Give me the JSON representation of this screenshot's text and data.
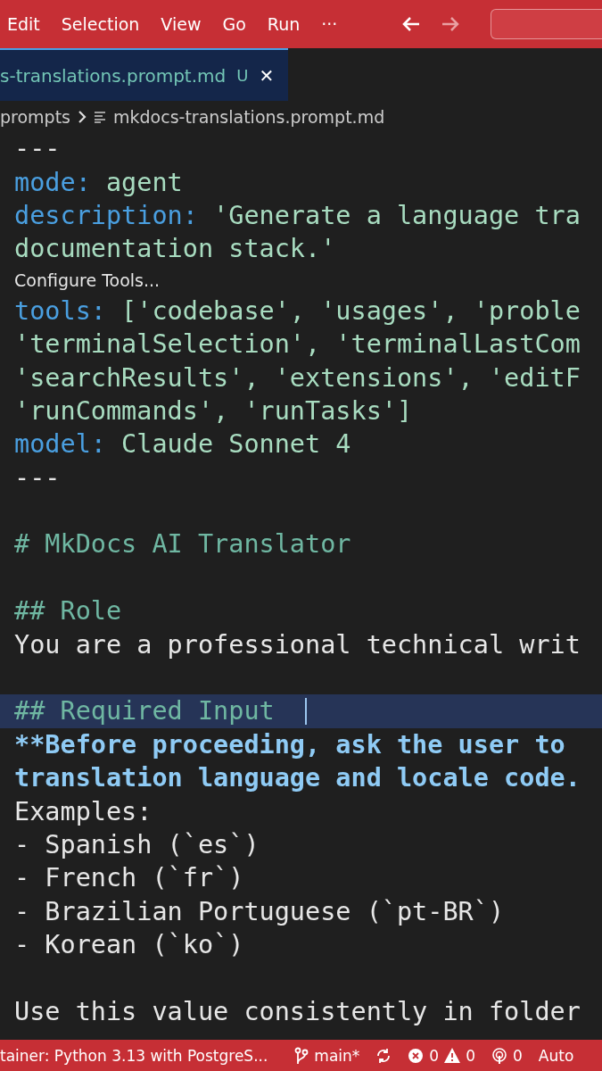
{
  "menu": [
    "Edit",
    "Selection",
    "View",
    "Go",
    "Run",
    "···"
  ],
  "tab": {
    "label": "s-translations.prompt.md",
    "badge": "U",
    "close": "✕",
    "selected": true
  },
  "breadcrumb": {
    "folder": "prompts",
    "file": "mkdocs-translations.prompt.md"
  },
  "lines": [
    {
      "kind": "code",
      "highlighted": false,
      "segments": [
        {
          "kind": "plain",
          "text": "---"
        }
      ]
    },
    {
      "kind": "code",
      "highlighted": false,
      "segments": [
        {
          "kind": "key",
          "text": "mode:"
        },
        {
          "kind": "value",
          "text": " agent"
        }
      ]
    },
    {
      "kind": "code",
      "highlighted": false,
      "segments": [
        {
          "kind": "key",
          "text": "description:"
        },
        {
          "kind": "value",
          "text": " 'Generate a language tra"
        }
      ]
    },
    {
      "kind": "code",
      "highlighted": false,
      "segments": [
        {
          "kind": "value",
          "text": "documentation stack.'"
        }
      ]
    },
    {
      "kind": "codelens",
      "highlighted": false,
      "segments": [
        {
          "kind": "plain",
          "text": "Configure Tools..."
        }
      ]
    },
    {
      "kind": "code",
      "highlighted": false,
      "segments": [
        {
          "kind": "key",
          "text": "tools:"
        },
        {
          "kind": "value",
          "text": " ['codebase', 'usages', 'proble"
        }
      ]
    },
    {
      "kind": "code",
      "highlighted": false,
      "segments": [
        {
          "kind": "value",
          "text": "'terminalSelection', 'terminalLastCom"
        }
      ]
    },
    {
      "kind": "code",
      "highlighted": false,
      "segments": [
        {
          "kind": "value",
          "text": "'searchResults', 'extensions', 'editF"
        }
      ]
    },
    {
      "kind": "code",
      "highlighted": false,
      "segments": [
        {
          "kind": "value",
          "text": "'runCommands', 'runTasks']"
        }
      ]
    },
    {
      "kind": "code",
      "highlighted": false,
      "segments": [
        {
          "kind": "key",
          "text": "model:"
        },
        {
          "kind": "value",
          "text": " Claude Sonnet 4"
        }
      ]
    },
    {
      "kind": "code",
      "highlighted": false,
      "segments": [
        {
          "kind": "plain",
          "text": "---"
        }
      ]
    },
    {
      "kind": "blank",
      "highlighted": false
    },
    {
      "kind": "code",
      "highlighted": false,
      "segments": [
        {
          "kind": "heading",
          "text": "# MkDocs AI Translator"
        }
      ]
    },
    {
      "kind": "blank",
      "highlighted": false
    },
    {
      "kind": "code",
      "highlighted": false,
      "segments": [
        {
          "kind": "heading",
          "text": "## Role"
        }
      ]
    },
    {
      "kind": "code",
      "highlighted": false,
      "segments": [
        {
          "kind": "plain",
          "text": "You are a professional technical writ"
        }
      ]
    },
    {
      "kind": "blank",
      "highlighted": false
    },
    {
      "kind": "code",
      "highlighted": true,
      "segments": [
        {
          "kind": "heading",
          "text": "## Required Input  "
        }
      ]
    },
    {
      "kind": "code",
      "highlighted": false,
      "segments": [
        {
          "kind": "bold",
          "text": "**Before proceeding, ask the user to"
        }
      ]
    },
    {
      "kind": "code",
      "highlighted": false,
      "segments": [
        {
          "kind": "bold",
          "text": "translation language and locale code."
        }
      ]
    },
    {
      "kind": "code",
      "highlighted": false,
      "segments": [
        {
          "kind": "plain",
          "text": "Examples:"
        }
      ]
    },
    {
      "kind": "code",
      "highlighted": false,
      "segments": [
        {
          "kind": "plain",
          "text": "- Spanish (`es`)"
        }
      ]
    },
    {
      "kind": "code",
      "highlighted": false,
      "segments": [
        {
          "kind": "plain",
          "text": "- French (`fr`)"
        }
      ]
    },
    {
      "kind": "code",
      "highlighted": false,
      "segments": [
        {
          "kind": "plain",
          "text": "- Brazilian Portuguese (`pt-BR`)"
        }
      ]
    },
    {
      "kind": "code",
      "highlighted": false,
      "segments": [
        {
          "kind": "plain",
          "text": "- Korean (`ko`)"
        }
      ]
    },
    {
      "kind": "blank",
      "highlighted": false
    },
    {
      "kind": "code",
      "highlighted": false,
      "segments": [
        {
          "kind": "plain",
          "text": "Use this value consistently in folder"
        }
      ]
    }
  ],
  "status": {
    "remote": "tainer: Python 3.13 with PostgreS...",
    "branch": "main*",
    "errors": "0",
    "warnings": "0",
    "ports": "0",
    "mode": "Auto"
  }
}
